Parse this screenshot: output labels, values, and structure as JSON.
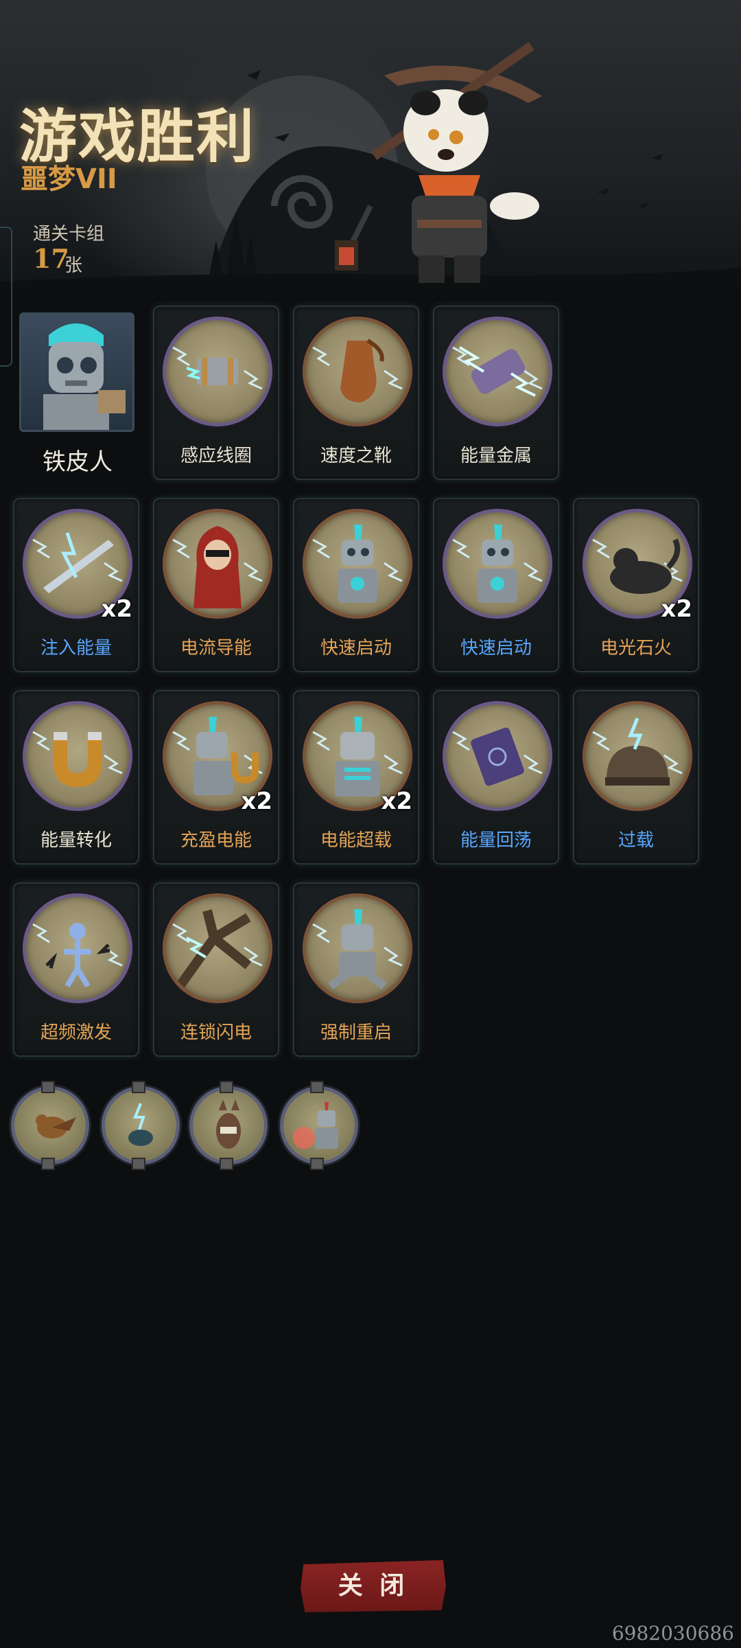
{
  "header": {
    "title": "游戏胜利",
    "subtitle": "噩梦VII",
    "deck_label": "通关卡组",
    "deck_count": "17",
    "deck_unit": "张"
  },
  "hero": {
    "name": "铁皮人"
  },
  "cards": [
    {
      "label": "感应线圈",
      "color": "white",
      "multiplier": "",
      "icon": "coil-icon"
    },
    {
      "label": "速度之靴",
      "color": "white",
      "multiplier": "",
      "icon": "boot-icon"
    },
    {
      "label": "能量金属",
      "color": "white",
      "multiplier": "",
      "icon": "metal-bar-icon"
    },
    {
      "label": "注入能量",
      "color": "blue",
      "multiplier": "x2",
      "icon": "lightning-sword-icon"
    },
    {
      "label": "电流导能",
      "color": "orange",
      "multiplier": "",
      "icon": "hooded-figure-icon"
    },
    {
      "label": "快速启动",
      "color": "orange",
      "multiplier": "",
      "icon": "robot-icon"
    },
    {
      "label": "快速启动",
      "color": "blue",
      "multiplier": "",
      "icon": "robot-icon"
    },
    {
      "label": "电光石火",
      "color": "orange",
      "multiplier": "x2",
      "icon": "panther-icon"
    },
    {
      "label": "能量转化",
      "color": "white",
      "multiplier": "",
      "icon": "magnet-icon"
    },
    {
      "label": "充盈电能",
      "color": "orange",
      "multiplier": "x2",
      "icon": "robot-magnet-icon"
    },
    {
      "label": "电能超载",
      "color": "orange",
      "multiplier": "x2",
      "icon": "robot-charged-icon"
    },
    {
      "label": "能量回荡",
      "color": "blue",
      "multiplier": "",
      "icon": "card-lightning-icon"
    },
    {
      "label": "过载",
      "color": "blue",
      "multiplier": "",
      "icon": "dome-icon"
    },
    {
      "label": "超频激发",
      "color": "orange",
      "multiplier": "",
      "icon": "lightning-figure-icon"
    },
    {
      "label": "连锁闪电",
      "color": "orange",
      "multiplier": "",
      "icon": "tree-lightning-icon"
    },
    {
      "label": "强制重启",
      "color": "orange",
      "multiplier": "",
      "icon": "robot-sitting-icon"
    }
  ],
  "relics": [
    {
      "icon": "bird-icon"
    },
    {
      "icon": "lightning-pot-icon"
    },
    {
      "icon": "wolf-icon"
    },
    {
      "icon": "robot-shooting-icon"
    }
  ],
  "footer": {
    "close_label": "关 闭",
    "serial": "6982030686"
  },
  "colors": {
    "orange": "#e5a457",
    "blue": "#58a6ff",
    "white": "#e9e3d2",
    "close_red": "#8a2423"
  }
}
